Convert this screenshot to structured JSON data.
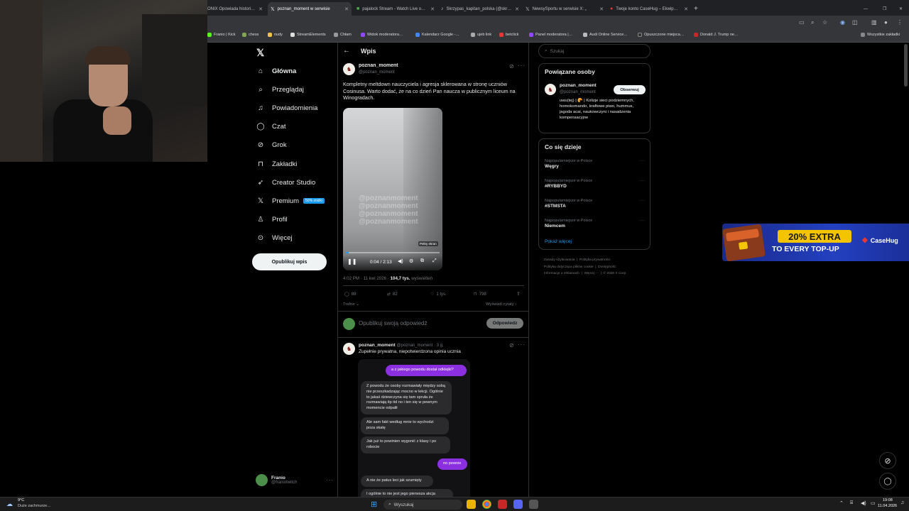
{
  "browser": {
    "tabs": [
      {
        "label": "ONIX Opowiada histori…",
        "active": false
      },
      {
        "label": "poznan_moment w serwisie",
        "active": true
      },
      {
        "label": "pajalock Stream - Watch Live o…",
        "active": false
      },
      {
        "label": "Skrzypas_kapitan_polska (@skr…",
        "active": false
      },
      {
        "label": "NewsySportu w serwisie X: „",
        "active": false
      },
      {
        "label": "Twoje konto CaseHug – Ekwip…",
        "active": false
      }
    ],
    "bookmarks": [
      "Franio | Kick",
      "chess",
      "nudy",
      "StreamElements",
      "Chłam",
      "Widok moderatora…",
      "Kalendarz Google -…",
      "ujeb link",
      "betclick",
      "Panel moderatora |…",
      "Audi Online Service…",
      "Opuszczone miejsca…",
      "Donald J. Trump ne…"
    ],
    "all_bookmarks": "Wszystkie zakładki"
  },
  "nav": {
    "items": [
      {
        "label": "Główna",
        "icon": "home-icon"
      },
      {
        "label": "Przeglądaj",
        "icon": "search-icon"
      },
      {
        "label": "Powiadomienia",
        "icon": "bell-icon"
      },
      {
        "label": "Czat",
        "icon": "chat-icon"
      },
      {
        "label": "Grok",
        "icon": "grok-icon"
      },
      {
        "label": "Zakładki",
        "icon": "bookmark-icon"
      },
      {
        "label": "Creator Studio",
        "icon": "rocket-icon"
      },
      {
        "label": "Premium",
        "icon": "x-logo-icon"
      },
      {
        "label": "Profil",
        "icon": "person-icon"
      },
      {
        "label": "Więcej",
        "icon": "more-circle-icon"
      }
    ],
    "premium_badge": "50% zniżki",
    "post_button": "Opublikuj wpis",
    "account": {
      "name": "Franio",
      "handle": "@franiotwitch"
    }
  },
  "post": {
    "header_title": "Wpis",
    "author": "poznan_moment",
    "handle": "@poznan_moment",
    "text": "Kompletny meltdown nauczyciela i agresja sklerowana w stronę uczniów Cosinusa. Warto dodać, że na co dzień Pan naucza w publicznym liceum na Winogradach.",
    "video": {
      "watermark": "@poznanmoment",
      "time": "0:04 / 2:13",
      "fullscreen_tooltip": "Pełny ekran"
    },
    "meta_time": "4:02 PM · 11 kwi 2026 · ",
    "views_value": "104,7 tys.",
    "views_label": " wyświetleń",
    "stats": {
      "replies": "89",
      "reposts": "82",
      "likes": "1 tys.",
      "bookmarks": "798"
    },
    "sort_label": "Trafne",
    "quotes_link": "Wyświetl cytaty",
    "reply_placeholder": "Opublikuj swoją odpowiedź",
    "reply_button": "Odpowiedz"
  },
  "reply": {
    "author": "poznan_moment",
    "handle_time": "@poznan_moment · 3 g.",
    "text": "Zupełnie prywatna, niepotwierdzona opinia ucznia",
    "messages": [
      {
        "from": "me",
        "text": "a z jakiego powodu dostał odklejki?"
      },
      {
        "from": "them",
        "text": "Z powodu że osoby rozmawiały między sobą nie przeszkadzając mocno w lekcji. Ogólnie to jakaś dziewczyna się tam spruła że rozmawiają itp itd no i ten się w pewnym momencie odpalił"
      },
      {
        "from": "them",
        "text": "Ale sam fakt według mnie to wychodzi poza skalę"
      },
      {
        "from": "them",
        "text": "Jak już to powinien wygonić z klasy i po robocie"
      },
      {
        "from": "me",
        "text": "no pewnie"
      },
      {
        "from": "them",
        "text": "A nie że patus leci jak szurnięty"
      },
      {
        "from": "them",
        "text": "I ogólnie to nie jest jego pierwsza akcja"
      }
    ]
  },
  "sidebar": {
    "search_placeholder": "Szukaj",
    "related_title": "Powiązane osoby",
    "related_person": {
      "name": "poznan_moment",
      "handle": "@poznan_moment",
      "follow": "Obserwuj",
      "bio": "uwu(tej) | 🥐 | Kolizje sieci podziemnych, homokomando, kraftowe piwo, hummus, jagoda acai, naukowczyni i nasadzenia kompensacyjne"
    },
    "trending_title": "Co się dzieje",
    "trends": [
      {
        "context": "Najpopularniejsze w Polsce",
        "name": "Węgry"
      },
      {
        "context": "Najpopularniejsze w Polsce",
        "name": "#RYBBYD"
      },
      {
        "context": "Najpopularniejsze w Polsce",
        "name": "#STMSTA"
      },
      {
        "context": "Najpopularniejsze w Polsce",
        "name": "Niemcem"
      }
    ],
    "show_more": "Pokaż więcej",
    "footer": [
      "Zasady użytkowania",
      "Polityka prywatności",
      "Polityka dotycząca plików cookie",
      "Dostępność",
      "Informacje o reklamach",
      "Więcej ···",
      "© 2026 X Corp."
    ]
  },
  "ad": {
    "line1": "20% EXTRA",
    "line2": "TO EVERY TOP-UP",
    "brand": "CaseHug"
  },
  "taskbar": {
    "weather_temp": "9°C",
    "weather_desc": "Duże zachmurze…",
    "search": "Wyszukaj",
    "time": "19:08",
    "date": "11.04.2026"
  },
  "colors": {
    "accent": "#1d9bf0",
    "bubble_me": "#8b2fe0",
    "ad_yellow": "#f5c400",
    "ad_blue": "#1e3fb5"
  }
}
